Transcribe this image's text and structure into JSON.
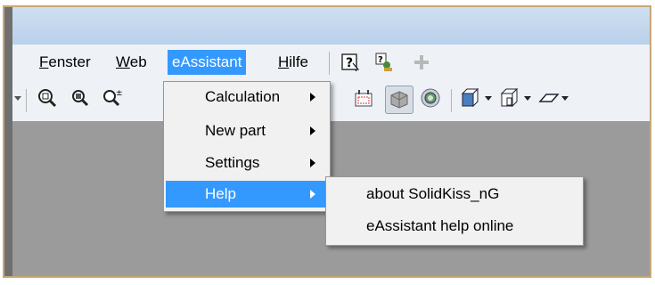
{
  "menubar": {
    "fenster_prefix": "F",
    "fenster_rest": "enster",
    "web_prefix": "W",
    "web_rest": "eb",
    "eassistant": "eAssistant",
    "hilfe_prefix": "H",
    "hilfe_rest": "ilfe"
  },
  "dropdown": {
    "items": [
      {
        "label": "Calculation"
      },
      {
        "label": "New part"
      },
      {
        "label": "Settings"
      },
      {
        "label": "Help"
      }
    ]
  },
  "submenu": {
    "items": [
      {
        "label": "about SolidKiss_nG"
      },
      {
        "label": "eAssistant help online"
      }
    ]
  },
  "colors": {
    "highlight": "#3399ff",
    "frame": "#c7a876",
    "workarea": "#9b9b9b"
  }
}
